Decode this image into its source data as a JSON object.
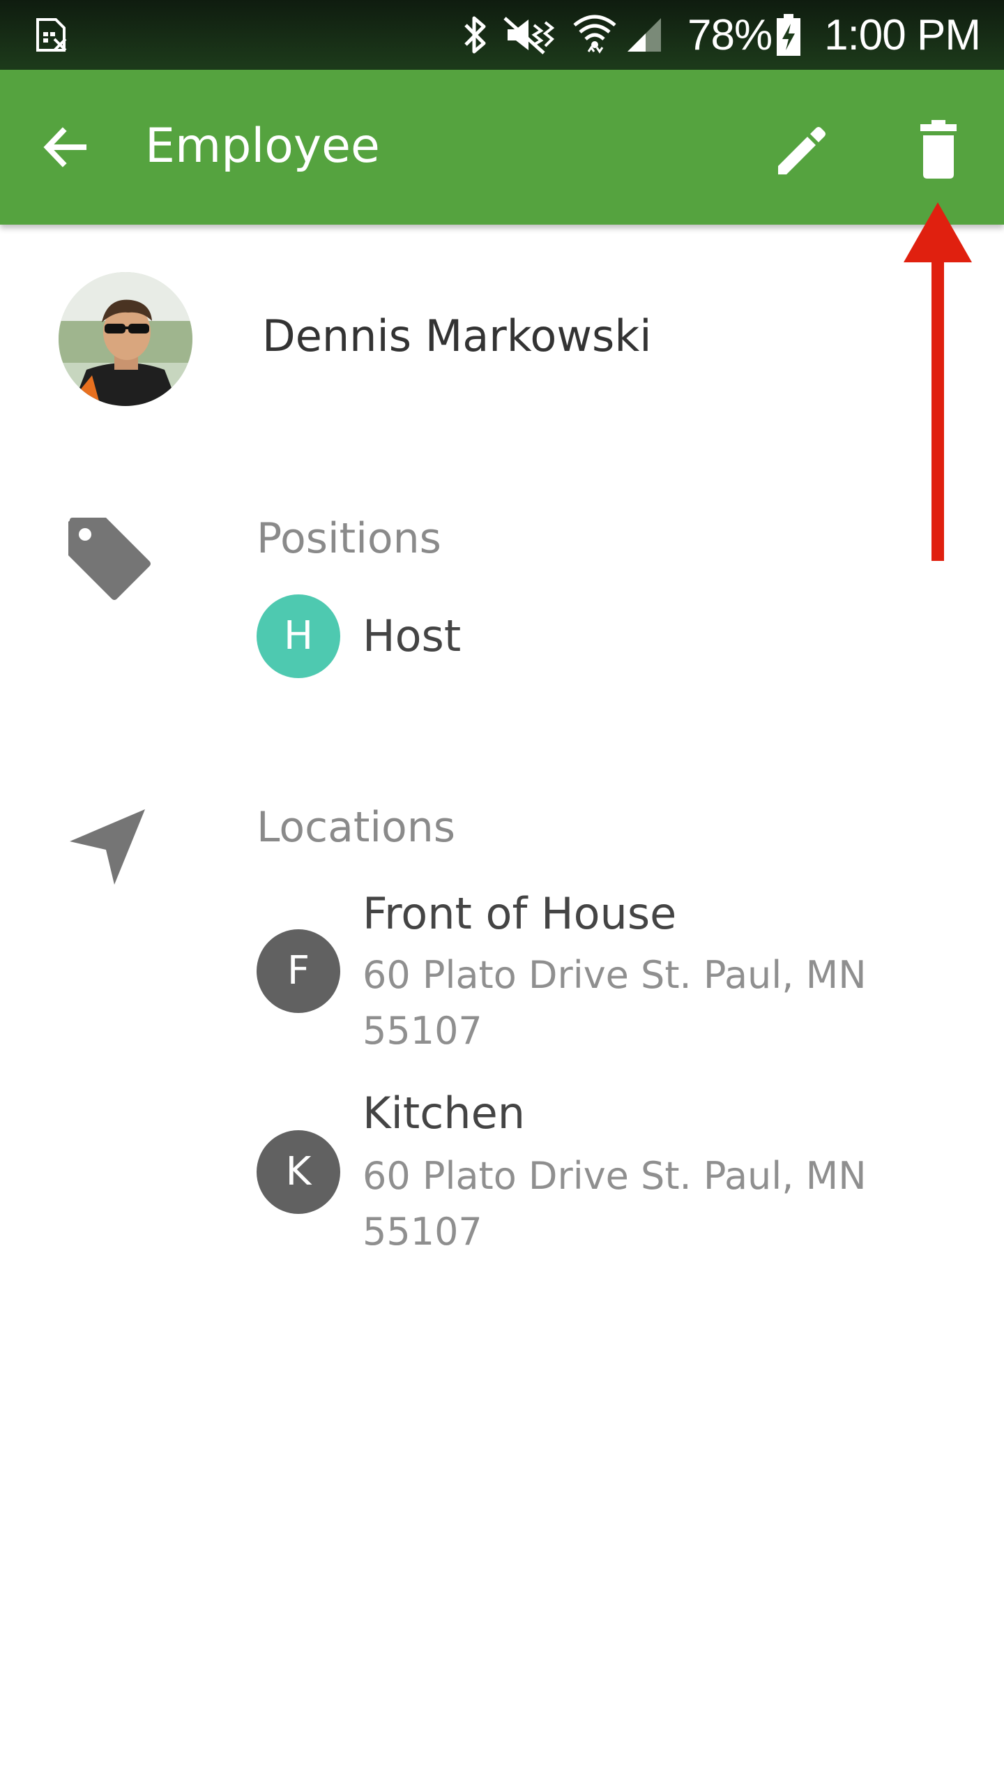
{
  "status_bar": {
    "battery_percent": "78%",
    "time": "1:00 PM",
    "icons": [
      "sim-card-icon",
      "bluetooth-icon",
      "vibrate-mute-icon",
      "wifi-icon",
      "signal-icon",
      "battery-charging-icon"
    ]
  },
  "app_bar": {
    "title": "Employee",
    "back_icon": "arrow-back-icon",
    "edit_icon": "pencil-icon",
    "delete_icon": "trash-icon",
    "background_color": "#55a33f"
  },
  "employee": {
    "name": "Dennis Markowski"
  },
  "positions": {
    "label": "Positions",
    "icon": "tag-icon",
    "items": [
      {
        "initial": "H",
        "name": "Host",
        "color": "#4ec9b0"
      }
    ]
  },
  "locations": {
    "label": "Locations",
    "icon": "navigation-icon",
    "items": [
      {
        "initial": "F",
        "name": "Front of House",
        "address": "60 Plato Drive St. Paul, MN 55107",
        "color": "#616161"
      },
      {
        "initial": "K",
        "name": "Kitchen",
        "address": "60 Plato Drive St. Paul, MN 55107",
        "color": "#616161"
      }
    ]
  },
  "annotation": {
    "arrow_color": "#e0200f",
    "points_to": "delete-button"
  }
}
